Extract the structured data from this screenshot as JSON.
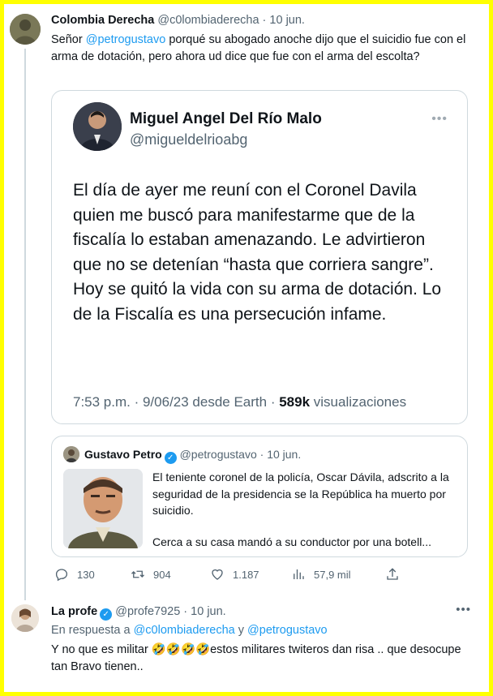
{
  "tweet": {
    "author_name": "Colombia Derecha",
    "author_handle": "@c0lombiaderecha",
    "separator": "·",
    "date": "10 jun.",
    "text_before": "Señor ",
    "mention": "@petrogustavo",
    "text_after": " porqué su abogado anoche dijo que el suicidio fue con el arma de dotación, pero ahora ud dice que fue con el arma del escolta?"
  },
  "embedded_screenshot": {
    "author_name": "Miguel Angel Del Río Malo",
    "author_handle": "@migueldelrioabg",
    "more_icon": "more-horizontal-icon",
    "text": "El día de ayer me reuní con el Coronel Davila quien me buscó para manifestarme que de la fiscalía lo estaban amenazando. Le advirtieron que no se detenían “hasta que corriera sangre”. Hoy se quitó la vida con su arma de dotación. Lo de la Fiscalía es una persecución infame.",
    "meta_time": "7:53 p.m. · 9/06/23 desde Earth · ",
    "views_count": "589k",
    "views_label": " visualizaciones"
  },
  "quoted_tweet": {
    "author_name": "Gustavo Petro",
    "verified_icon": "verified-badge-icon",
    "author_handle": "@petrogustavo",
    "separator": "·",
    "date": "10 jun.",
    "text": "El teniente coronel de la policía, Oscar Dávila, adscrito a la seguridad de la presidencia se la República ha muerto por suicidio.",
    "text2": "Cerca a su casa mandó a su conductor por una botell..."
  },
  "actions": {
    "replies": "130",
    "retweets": "904",
    "likes": "1.187",
    "views": "57,9 mil"
  },
  "reply": {
    "author_name": "La profe",
    "verified_icon": "verified-badge-icon",
    "author_handle": "@profe7925",
    "separator": "·",
    "date": "10 jun.",
    "in_reply_prefix": "En respuesta a ",
    "in_reply_user1": "@c0lombiaderecha",
    "in_reply_and": " y ",
    "in_reply_user2": "@petrogustavo",
    "text_before": "Y no que es militar ",
    "emojis": "🤣🤣🤣🤣",
    "text_after": "estos militares  twiteros dan risa .. que desocupe tan Bravo tienen.."
  },
  "colors": {
    "frame_border": "#ffff00",
    "accent": "#1d9bf0",
    "secondary_text": "#536471"
  }
}
